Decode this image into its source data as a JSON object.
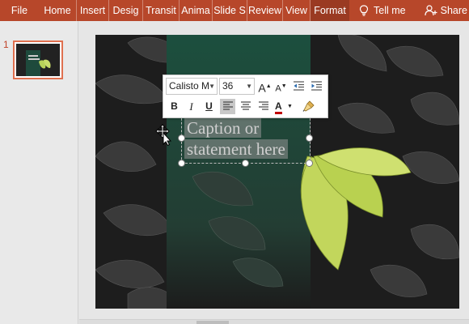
{
  "ribbon": {
    "tabs": [
      "File",
      "Home",
      "Insert",
      "Desig",
      "Transit",
      "Anima",
      "Slide S",
      "Review",
      "View",
      "Format"
    ],
    "active_tab": "Format",
    "tell_me": "Tell me",
    "share": "Share",
    "accent_color": "#b7472a"
  },
  "thumbnails": {
    "slide_number": "1",
    "selected_border_color": "#e0704f"
  },
  "slide": {
    "caption_line1": "Caption or",
    "caption_line2": "statement here"
  },
  "mini_toolbar": {
    "font_name": "Calisto M",
    "font_size": "36",
    "bold": "B",
    "italic": "I",
    "underline": "U",
    "grow_font": "A",
    "shrink_font": "A",
    "font_color_label": "A",
    "font_color": "#c00000",
    "icons": [
      "increase-font-size-icon",
      "decrease-font-size-icon",
      "decrease-indent-icon",
      "increase-indent-icon",
      "align-left-icon",
      "align-center-icon",
      "align-right-icon",
      "font-color-icon",
      "format-painter-icon"
    ]
  }
}
